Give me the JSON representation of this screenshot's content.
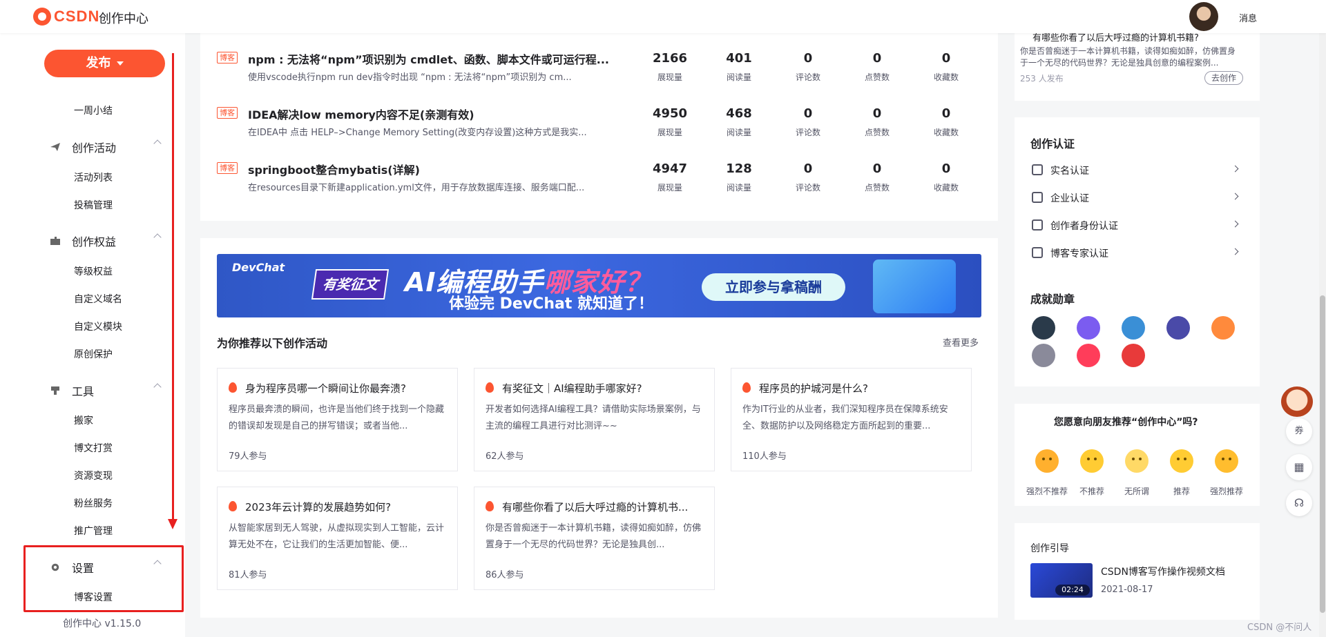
{
  "topbar": {
    "logo_text": "CSDN",
    "title": "创作中心",
    "messages": "消息"
  },
  "sidebar": {
    "publish": "发布",
    "weekly": "一周小结",
    "groups": [
      {
        "label": "创作活动",
        "icon": "paper-plane-icon",
        "items": [
          "活动列表",
          "投稿管理"
        ]
      },
      {
        "label": "创作权益",
        "icon": "gift-icon",
        "items": [
          "等级权益",
          "自定义域名",
          "自定义模块",
          "原创保护"
        ]
      },
      {
        "label": "工具",
        "icon": "tool-icon",
        "items": [
          "搬家",
          "博文打赏",
          "资源变现",
          "粉丝服务",
          "推广管理"
        ]
      },
      {
        "label": "设置",
        "icon": "gear-icon",
        "items": [
          "博客设置"
        ]
      }
    ],
    "version": "创作中心 v1.15.0"
  },
  "articles": [
    {
      "tag": "博客",
      "title": "npm : 无法将“npm”项识别为 cmdlet、函数、脚本文件或可运行程...",
      "desc": "使用vscode执行npm run dev指令时出现 “npm : 无法将“npm”项识别为 cm...",
      "stats": [
        "2166",
        "401",
        "0",
        "0",
        "0"
      ]
    },
    {
      "tag": "博客",
      "title": "IDEA解决low memory内容不足(亲测有效)",
      "desc": "在IDEA中 点击 HELP–>Change Memory Setting(改变内存设置)这种方式是我实...",
      "stats": [
        "4950",
        "468",
        "0",
        "0",
        "0"
      ]
    },
    {
      "tag": "博客",
      "title": "springboot整合mybatis(详解)",
      "desc": "在resources目录下新建application.yml文件，用于存放数据库连接、服务端口配...",
      "stats": [
        "4947",
        "128",
        "0",
        "0",
        "0"
      ]
    }
  ],
  "stat_labels": [
    "展现量",
    "阅读量",
    "评论数",
    "点赞数",
    "收藏数"
  ],
  "banner": {
    "brand": "DevChat",
    "tag": "有奖征文",
    "headline_a": "AI编程助手",
    "headline_b": "哪家好？",
    "sub": "体验完 DevChat 就知道了！",
    "cta": "立即参与拿稿酬"
  },
  "recommend": {
    "title": "为你推荐以下创作活动",
    "more": "查看更多",
    "cards": [
      {
        "title": "身为程序员哪一个瞬间让你最奔溃?",
        "desc": "程序员最奔溃的瞬间，也许是当他们终于找到一个隐藏的错误却发现是自己的拼写错误；或者当他...",
        "join": "79人参与"
      },
      {
        "title": "有奖征文｜AI编程助手哪家好?",
        "desc": "开发者如何选择AI编程工具？请借助实际场景案例，与主流的编程工具进行对比测评~~",
        "join": "62人参与"
      },
      {
        "title": "程序员的护城河是什么?",
        "desc": "作为IT行业的从业者，我们深知程序员在保障系统安全、数据防护以及网络稳定方面所起到的重要...",
        "join": "110人参与"
      },
      {
        "title": "2023年云计算的发展趋势如何?",
        "desc": "从智能家居到无人驾驶，从虚拟现实到人工智能，云计算无处不在，它让我们的生活更加智能、便...",
        "join": "81人参与"
      },
      {
        "title": "有哪些你看了以后大呼过瘾的计算机书...",
        "desc": "你是否曾痴迷于一本计算机书籍，读得如痴如醉，仿佛置身于一个无尽的代码世界？无论是独具创...",
        "join": "86人参与"
      }
    ]
  },
  "right": {
    "top_card": {
      "title": "有哪些你看了以后大呼过瘾的计算机书籍?",
      "desc": "你是否曾痴迷于一本计算机书籍，读得如痴如醉，仿佛置身于一个无尽的代码世界？无论是独具创意的编程案例...",
      "count": "253 人发布",
      "btn": "去创作"
    },
    "auth_title": "创作认证",
    "auth_items": [
      "实名认证",
      "企业认证",
      "创作者身份认证",
      "博客专家认证"
    ],
    "badges_title": "成就勋章",
    "badge_colors": [
      "#2a3a4a",
      "#7b5cf0",
      "#3a8fd6",
      "#4a4aa8",
      "#ff8a3c",
      "#8a8a9a",
      "#ff3d5a",
      "#e83a3a"
    ],
    "survey": {
      "question": "您愿意向朋友推荐“创作中心”吗?",
      "options": [
        "强烈不推荐",
        "不推荐",
        "无所谓",
        "推荐",
        "强烈推荐"
      ]
    },
    "guide": {
      "title": "创作引导",
      "item": "CSDN博客写作操作视频文档",
      "date": "2021-08-17",
      "duration": "02:24"
    }
  },
  "float": {
    "coupon": "券"
  },
  "watermark": "CSDN @不问人"
}
